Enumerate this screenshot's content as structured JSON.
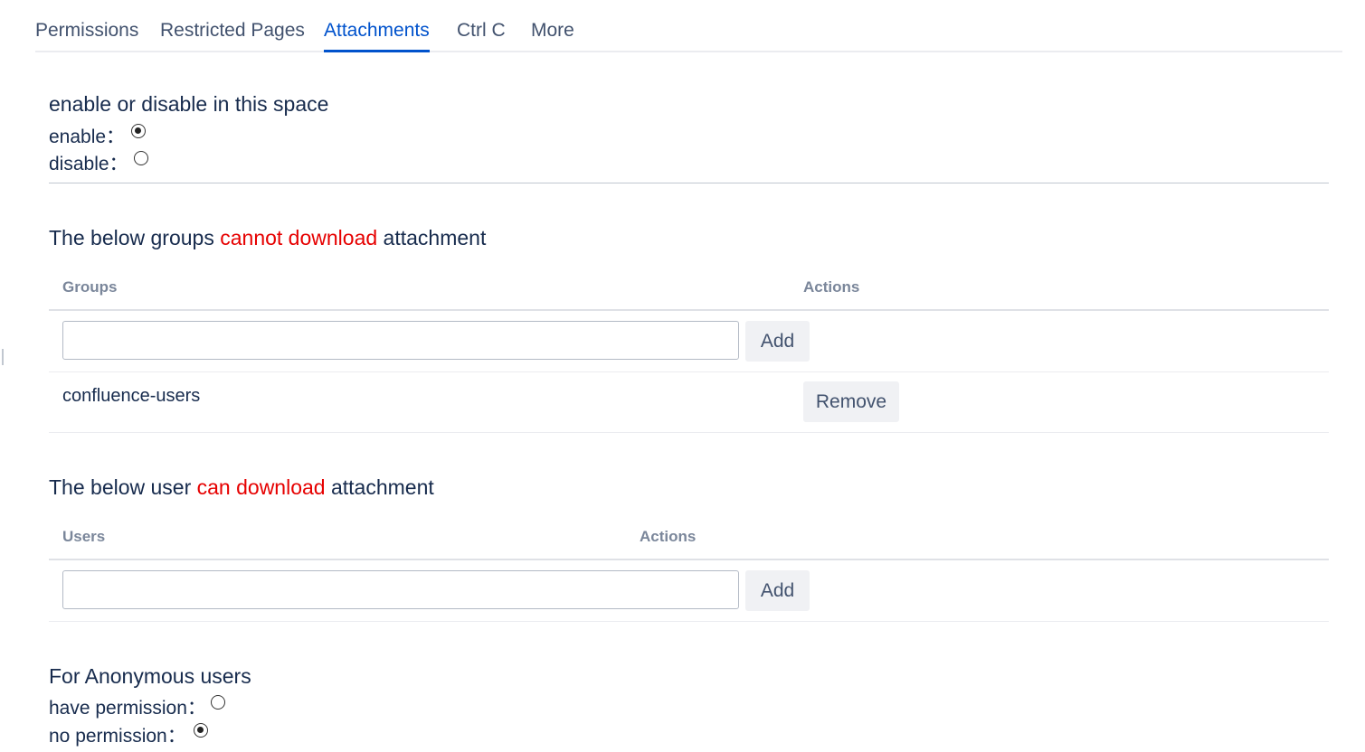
{
  "tabs": [
    {
      "label": "Permissions",
      "active": false
    },
    {
      "label": "Restricted Pages",
      "active": false
    },
    {
      "label": "Attachments",
      "active": true
    },
    {
      "label": "Ctrl C",
      "active": false
    },
    {
      "label": "More",
      "active": false
    }
  ],
  "space_toggle": {
    "title": "enable or disable in this space",
    "enable_label": "enable：",
    "disable_label": "disable：",
    "selected": "enable"
  },
  "groups_section": {
    "title_pre": "The below groups ",
    "title_highlight": "cannot download",
    "title_post": " attachment",
    "col_groups": "Groups",
    "col_actions": "Actions",
    "input_value": "",
    "input_placeholder": "",
    "add_label": "Add",
    "rows": [
      {
        "name": "confluence-users",
        "action": "Remove"
      }
    ]
  },
  "users_section": {
    "title_pre": "The below user ",
    "title_highlight": "can download",
    "title_post": " attachment",
    "col_users": "Users",
    "col_actions": "Actions",
    "input_value": "",
    "input_placeholder": "",
    "add_label": "Add"
  },
  "anonymous": {
    "title": "For Anonymous users",
    "have_label": "have permission：",
    "no_label": "no permission：",
    "selected": "no"
  },
  "colors": {
    "accent": "#0052cc",
    "highlight": "#e60000"
  }
}
